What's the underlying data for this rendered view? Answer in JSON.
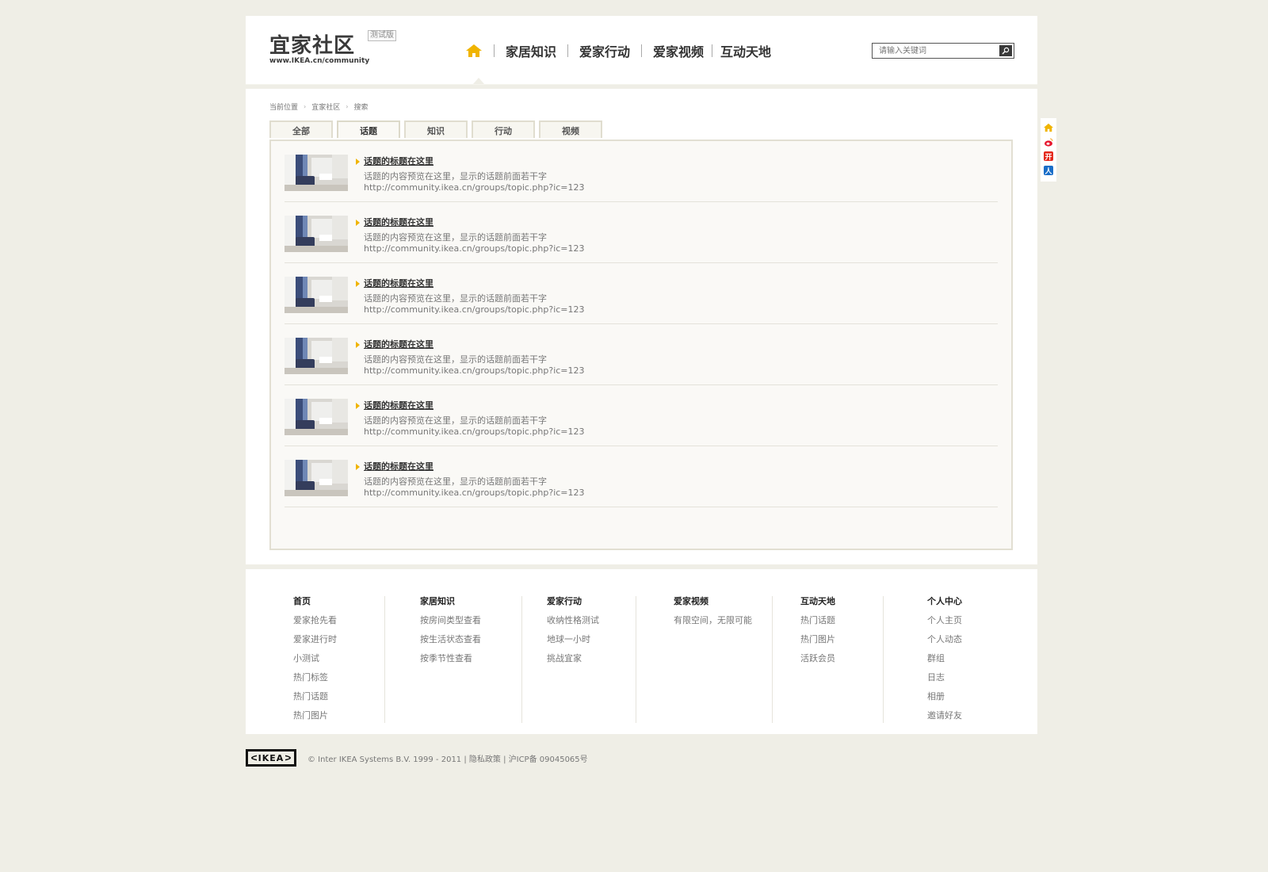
{
  "header": {
    "logo_title": "宜家社区",
    "logo_url": "www.IKEA.cn/community",
    "beta_badge": "测试版",
    "nav": [
      "家居知识",
      "爱家行动",
      "爱家视频",
      "互动天地"
    ],
    "search_placeholder": "请输入关键词",
    "colors": {
      "accent": "#f0b400",
      "text": "#333333"
    }
  },
  "breadcrumb": [
    "当前位置",
    "宜家社区",
    "搜索"
  ],
  "tabs": [
    "全部",
    "话题",
    "知识",
    "行动",
    "视频"
  ],
  "active_tab": "话题",
  "results": [
    {
      "title": "话题的标题在这里",
      "desc": "话题的内容预览在这里，显示的话题前面若干字",
      "url": "http://community.ikea.cn/groups/topic.php?ic=123"
    },
    {
      "title": "话题的标题在这里",
      "desc": "话题的内容预览在这里，显示的话题前面若干字",
      "url": "http://community.ikea.cn/groups/topic.php?ic=123"
    },
    {
      "title": "话题的标题在这里",
      "desc": "话题的内容预览在这里，显示的话题前面若干字",
      "url": "http://community.ikea.cn/groups/topic.php?ic=123"
    },
    {
      "title": "话题的标题在这里",
      "desc": "话题的内容预览在这里，显示的话题前面若干字",
      "url": "http://community.ikea.cn/groups/topic.php?ic=123"
    },
    {
      "title": "话题的标题在这里",
      "desc": "话题的内容预览在这里，显示的话题前面若干字",
      "url": "http://community.ikea.cn/groups/topic.php?ic=123"
    },
    {
      "title": "话题的标题在这里",
      "desc": "话题的内容预览在这里，显示的话题前面若干字",
      "url": "http://community.ikea.cn/groups/topic.php?ic=123"
    }
  ],
  "footer": {
    "columns": [
      {
        "title": "首页",
        "items": [
          "爱家抢先看",
          "爱家进行时",
          "小测试",
          "热门标签",
          "热门话题",
          "热门图片"
        ]
      },
      {
        "title": "家居知识",
        "items": [
          "按房间类型查看",
          "按生活状态查看",
          "按季节性查看"
        ]
      },
      {
        "title": "爱家行动",
        "items": [
          "收纳性格测试",
          "地球一小时",
          "挑战宜家"
        ]
      },
      {
        "title": "爱家视频",
        "items": [
          "有限空间，无限可能"
        ]
      },
      {
        "title": "互动天地",
        "items": [
          "热门话题",
          "热门图片",
          "活跃会员"
        ]
      },
      {
        "title": "个人中心",
        "items": [
          "个人主页",
          "个人动态",
          "群组",
          "日志",
          "相册",
          "邀请好友"
        ]
      }
    ],
    "ikea_logo": "IKEA",
    "copyright": "© Inter IKEA Systems B.V. 1999 - 2011 | 隐私政策 | 沪ICP备 09045065号"
  },
  "side_share": [
    "home-icon",
    "weibo-icon",
    "kaixin-icon",
    "renren-icon"
  ]
}
